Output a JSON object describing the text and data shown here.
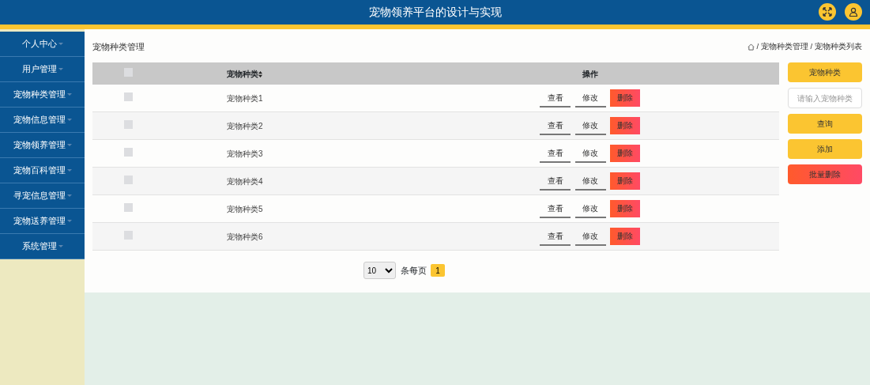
{
  "header": {
    "title": "宠物领养平台的设计与实现"
  },
  "sidebar": {
    "items": [
      {
        "label": "个人中心",
        "expanded": false
      },
      {
        "label": "用户管理",
        "expanded": false
      },
      {
        "label": "宠物种类管理",
        "expanded": false
      },
      {
        "label": "宠物信息管理",
        "expanded": false
      },
      {
        "label": "宠物领养管理",
        "expanded": false
      },
      {
        "label": "宠物百科管理",
        "expanded": false
      },
      {
        "label": "寻宠信息管理",
        "expanded": false
      },
      {
        "label": "宠物送养管理",
        "expanded": false
      },
      {
        "label": "系统管理",
        "expanded": false
      }
    ]
  },
  "page_title": "宠物种类管理",
  "breadcrumb": [
    {
      "separator": "/",
      "label": "宠物种类管理"
    },
    {
      "separator": "/",
      "label": "宠物种类列表"
    }
  ],
  "table": {
    "select_all": {
      "checked": false
    },
    "columns": [
      "宠物种类",
      "操作"
    ],
    "rows": [
      {
        "checked": false,
        "name": "宠物种类1",
        "actions": [
          "查看",
          "修改",
          "删除"
        ]
      },
      {
        "checked": false,
        "name": "宠物种类2",
        "actions": [
          "查看",
          "修改",
          "删除"
        ]
      },
      {
        "checked": false,
        "name": "宠物种类3",
        "actions": [
          "查看",
          "修改",
          "删除"
        ]
      },
      {
        "checked": false,
        "name": "宠物种类4",
        "actions": [
          "查看",
          "修改",
          "删除"
        ]
      },
      {
        "checked": false,
        "name": "宠物种类5",
        "actions": [
          "查看",
          "修改",
          "删除"
        ]
      },
      {
        "checked": false,
        "name": "宠物种类6",
        "actions": [
          "查看",
          "修改",
          "删除"
        ]
      }
    ]
  },
  "pagination": {
    "page_size": "10",
    "page_size_label": "条每页",
    "pages": [
      {
        "label": "1",
        "selected": true
      }
    ]
  },
  "filter": {
    "label": "宠物种类",
    "placeholder": "请输入宠物种类",
    "buttons": [
      {
        "label": "查询",
        "kind": "primary"
      },
      {
        "label": "添加",
        "kind": "primary"
      },
      {
        "label": "批量删除",
        "kind": "danger"
      }
    ]
  }
}
